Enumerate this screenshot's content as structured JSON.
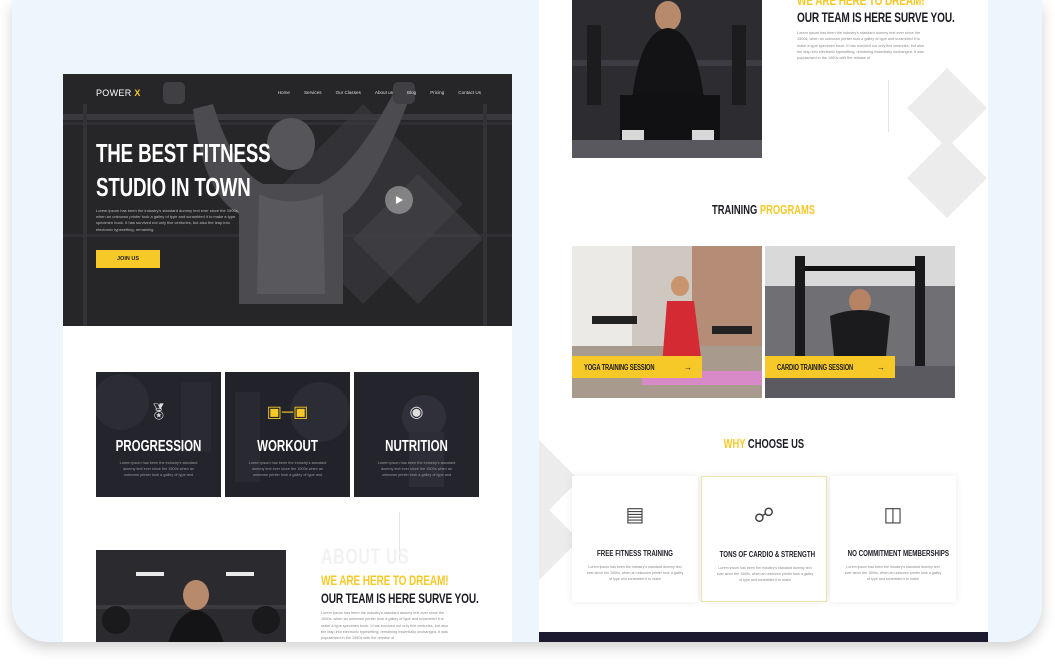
{
  "hero": {
    "logo_text": "POWER",
    "logo_accent": "X",
    "nav": [
      "Home",
      "Services",
      "Our Classes",
      "About us",
      "Blog",
      "Pricing",
      "Contact Us"
    ],
    "title_line1": "THE BEST FITNESS",
    "title_line2": "STUDIO IN TOWN",
    "description": "Lorem ipsum has been the industry's standard dummy text ever since the 1500s, when an unknown printer took a galley of type and scrambled it to make a type specimen book. It has survived not only five centuries, but also the leap into electronic typesetting, remaining",
    "join_label": "JOIN US",
    "play_icon": "play-icon"
  },
  "features": [
    {
      "title": "PROGRESSION",
      "icon": "medal-icon",
      "text": "Lorem ipsum has been the industry's standard dummy text ever since the 1500s when an unknown printer took a galley of type and",
      "highlight": false
    },
    {
      "title": "WORKOUT",
      "icon": "dumbbell-icon",
      "text": "Lorem ipsum has been the industry's standard dummy text ever since the 1500s when an unknown printer took a galley of type and",
      "highlight": true
    },
    {
      "title": "NUTRITION",
      "icon": "nutrition-icon",
      "text": "Lorem ipsum has been the industry's standard dummy text ever since the 1500s when an unknown printer took a galley of type and",
      "highlight": false
    }
  ],
  "about": {
    "watermark": "ABOUT US",
    "heading_yellow": "WE ARE HERE TO DREAM!",
    "heading_dark": "OUR TEAM IS HERE SURVE YOU.",
    "text": "Lorem ipsum has been the industry's standard dummy text ever since the 1500s, when an unknown printer took a galley of type and scrambled it to make a type specimen book. It has survived not only five centuries, but also the leap into electronic typesetting, remaining essentially unchanged. It was popularised in the 1960s with the release of"
  },
  "programs": {
    "heading_dark": "TRAINING",
    "heading_yellow": "PROGRAMS",
    "items": [
      {
        "label": "YOGA TRAINING SESSION"
      },
      {
        "label": "CARDIO TRAINING SESSION"
      }
    ]
  },
  "why": {
    "heading_yellow": "WHY",
    "heading_dark": "CHOOSE US",
    "cards": [
      {
        "title": "FREE FITNESS TRAINING",
        "icon": "muscle-icon",
        "text": "Lorem ipsum has been the industry's standard dummy text ever since the 1500s, when an unknown printer took a galley of type and scrambled it to make"
      },
      {
        "title": "TONS OF CARDIO & STRENGTH",
        "icon": "exercise-bike-icon",
        "text": "Lorem ipsum has been the industry's standard dummy text ever since the 1500s, when an unknown printer took a galley of type and scrambled it to make"
      },
      {
        "title": "NO COMMITMENT MEMBERSHIPS",
        "icon": "gift-icon",
        "text": "Lorem ipsum has been the industry's standard dummy text ever since the 1500s, when an unknown printer took a galley of type and scrambled it to make"
      }
    ]
  },
  "colors": {
    "accent": "#f6c928",
    "dark": "#1c1c24",
    "frame": "#eef6fd"
  }
}
